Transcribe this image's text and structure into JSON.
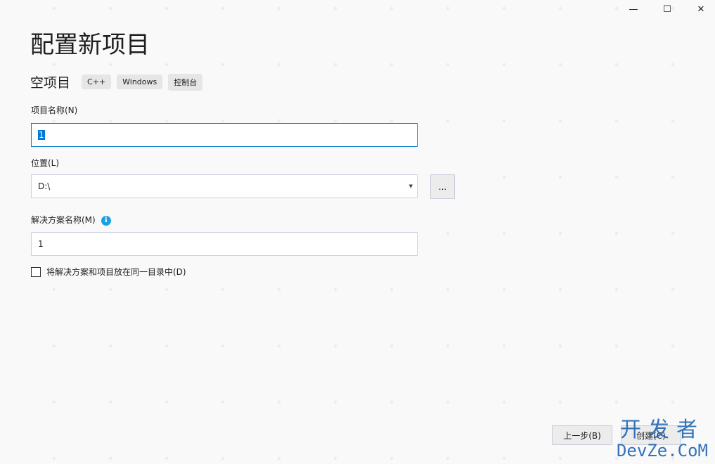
{
  "window": {
    "minimize_glyph": "—",
    "maximize_glyph": "☐",
    "close_glyph": "✕"
  },
  "page": {
    "title": "配置新项目",
    "template_name": "空项目",
    "tags": [
      "C++",
      "Windows",
      "控制台"
    ]
  },
  "form": {
    "project_name_label": "项目名称(N)",
    "project_name_value": "1",
    "location_label": "位置(L)",
    "location_value": "D:\\",
    "dropdown_arrow": "▼",
    "browse_label": "...",
    "solution_name_label": "解决方案名称(M)",
    "info_glyph": "i",
    "solution_name_value": "1",
    "same_dir_checkbox_label": "将解决方案和项目放在同一目录中(D)",
    "same_dir_checked": false
  },
  "footer": {
    "back_label": "上一步(B)",
    "create_label": "创建(C)"
  },
  "watermark": {
    "line1": "开发者",
    "line2": "DevZe.CoM"
  }
}
